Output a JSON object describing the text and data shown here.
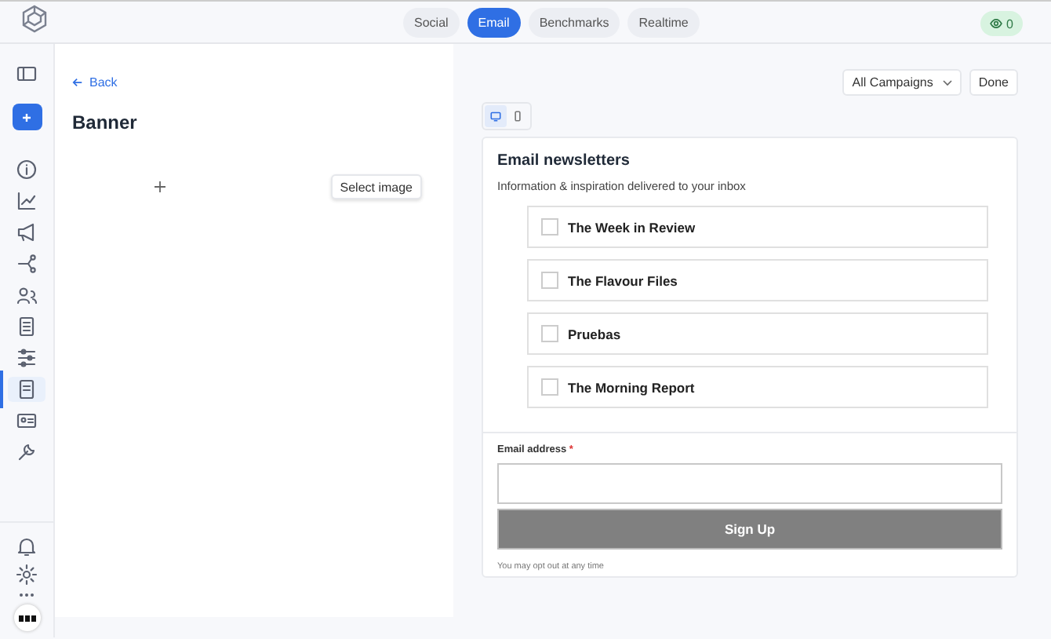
{
  "topbar": {
    "tabs": [
      {
        "label": "Social",
        "selected": false
      },
      {
        "label": "Email",
        "selected": true
      },
      {
        "label": "Benchmarks",
        "selected": false
      },
      {
        "label": "Realtime",
        "selected": false
      }
    ],
    "viewers": "0"
  },
  "sidebar": {
    "items": [
      {
        "kind": "info",
        "selected": false
      },
      {
        "kind": "chart",
        "selected": false
      },
      {
        "kind": "megaphone",
        "selected": false
      },
      {
        "kind": "share",
        "selected": false
      },
      {
        "kind": "users",
        "selected": false
      },
      {
        "kind": "list",
        "selected": false
      },
      {
        "kind": "sliders",
        "selected": false
      },
      {
        "kind": "doc",
        "selected": true
      },
      {
        "kind": "card",
        "selected": false
      },
      {
        "kind": "wrench",
        "selected": false
      }
    ]
  },
  "editor": {
    "back": "Back",
    "title": "Banner",
    "select_button": "Select image"
  },
  "preview": {
    "campaign_select": "All Campaigns",
    "done": "Done",
    "devices": [
      {
        "kind": "desktop",
        "selected": true
      },
      {
        "kind": "mobile",
        "selected": false
      }
    ],
    "heading": "Email newsletters",
    "subtitle": "Information & inspiration delivered to your inbox",
    "newsletters": [
      {
        "label": "The Week in Review",
        "checked": false
      },
      {
        "label": "The Flavour Files",
        "checked": false
      },
      {
        "label": "Pruebas",
        "checked": false
      },
      {
        "label": "The Morning Report",
        "checked": false
      }
    ],
    "email_label": "Email address",
    "required_mark": "*",
    "submit": "Sign Up",
    "note": "You may opt out at any time"
  }
}
